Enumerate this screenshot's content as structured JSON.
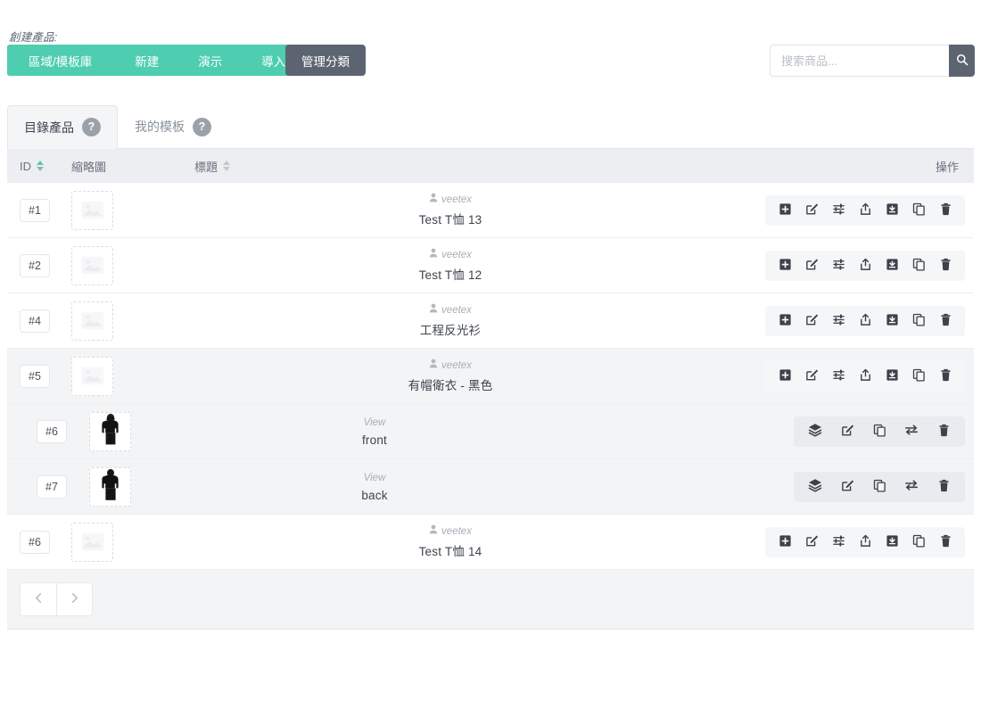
{
  "toolbar": {
    "create_label": "創建產品:",
    "buttons": [
      {
        "label": "區域/模板庫",
        "name": "design-template-library"
      },
      {
        "label": "新建",
        "name": "create-new"
      },
      {
        "label": "演示",
        "name": "demo"
      },
      {
        "label": "導入",
        "name": "import"
      }
    ],
    "manage_categories_label": "管理分類",
    "accent_green": "#4ecdb0",
    "dark_gray": "#5d6471"
  },
  "search": {
    "placeholder": "搜索商品...",
    "value": "",
    "button_icon": "search-icon"
  },
  "tabs": [
    {
      "label": "目錄產品",
      "help": "?",
      "active": true
    },
    {
      "label": "我的模板",
      "help": "?",
      "active": false
    }
  ],
  "table": {
    "headers": {
      "id": "ID",
      "thumbnail": "縮略圖",
      "title": "標題",
      "actions": "操作"
    },
    "sort": {
      "id_active": true,
      "title_active": false
    },
    "rows": [
      {
        "id": "#1",
        "owner": "veetex",
        "title": "Test T恤 13",
        "type": "product",
        "shaded": false,
        "thumb": "placeholder"
      },
      {
        "id": "#2",
        "owner": "veetex",
        "title": "Test T恤 12",
        "type": "product",
        "shaded": false,
        "thumb": "placeholder"
      },
      {
        "id": "#4",
        "owner": "veetex",
        "title": "工程反光衫",
        "type": "product",
        "shaded": false,
        "thumb": "placeholder"
      },
      {
        "id": "#5",
        "owner": "veetex",
        "title": "有帽衛衣 - 黑色",
        "type": "product",
        "shaded": true,
        "thumb": "placeholder"
      },
      {
        "id": "#6",
        "owner": "View",
        "title": "front",
        "type": "view",
        "shaded": true,
        "thumb": "hoodie-front"
      },
      {
        "id": "#7",
        "owner": "View",
        "title": "back",
        "type": "view",
        "shaded": true,
        "thumb": "hoodie-back"
      },
      {
        "id": "#6",
        "owner": "veetex",
        "title": "Test T恤 14",
        "type": "product",
        "shaded": false,
        "thumb": "placeholder"
      }
    ],
    "product_actions": [
      "add-icon",
      "edit-icon",
      "settings-icon",
      "share-icon",
      "save-icon",
      "duplicate-icon",
      "delete-icon"
    ],
    "view_actions": [
      "layers-icon",
      "edit-icon",
      "duplicate-icon",
      "swap-icon",
      "delete-icon"
    ]
  },
  "pagination": {
    "prev_icon": "chevron-left-icon",
    "next_icon": "chevron-right-icon"
  }
}
